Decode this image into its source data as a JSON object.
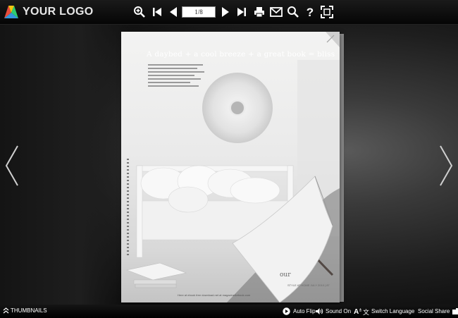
{
  "toolbar": {
    "logo_text": "YOUR LOGO",
    "page_indicator": "1/8",
    "icons": [
      "zoom-in-icon",
      "first-page-icon",
      "previous-page-icon",
      "next-page-icon",
      "last-page-icon",
      "print-icon",
      "email-icon",
      "search-icon",
      "help-icon",
      "fullscreen-icon"
    ]
  },
  "magazine": {
    "headline": "A daybed + a cool breeze + a great book = bliss",
    "footer_text": "Here at ebook free download.net at magazine&ebook.com",
    "page_number": "STYLE AT HOME  JULY 2010  |  87",
    "curl_label": "our"
  },
  "bottom_bar": {
    "thumbnails": "THUMBNAILS",
    "auto_flip": "Auto Flip",
    "sound": "Sound On",
    "switch_language": "Switch Language",
    "social_share": "Social Share"
  },
  "colors": {
    "toolbar_bg": "#0d0d0d",
    "icon": "#ffffff",
    "stage_bg": "#2a2a2a"
  }
}
